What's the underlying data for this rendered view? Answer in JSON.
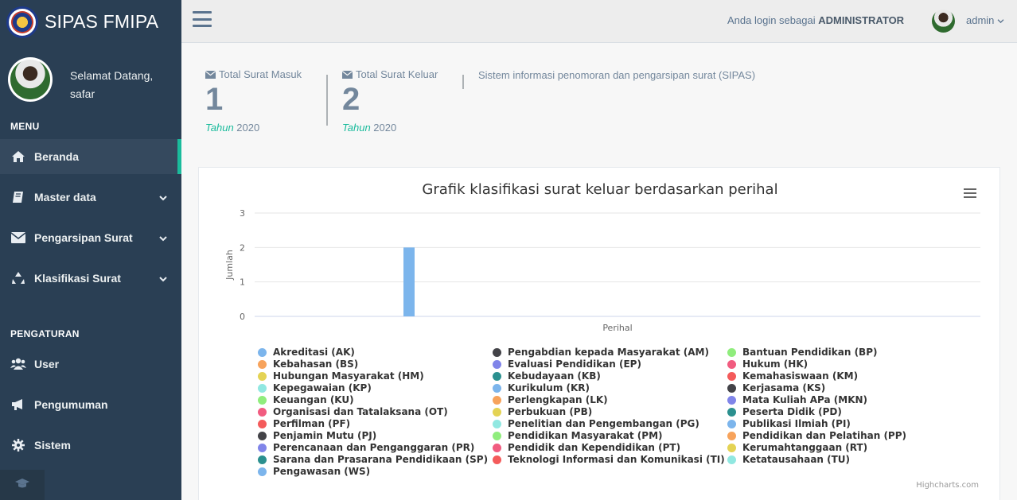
{
  "app": {
    "title": "SIPAS FMIPA"
  },
  "profile": {
    "greeting": "Selamat Datang,",
    "name": "safar"
  },
  "sidebar": {
    "menu_heading": "MENU",
    "items": [
      {
        "label": "Beranda",
        "icon": "home-icon"
      },
      {
        "label": "Master data",
        "icon": "book-icon"
      },
      {
        "label": "Pengarsipan Surat",
        "icon": "envelope-icon"
      },
      {
        "label": "Klasifikasi Surat",
        "icon": "recycle-icon"
      }
    ],
    "settings_heading": "PENGATURAN",
    "settings_items": [
      {
        "label": "User",
        "icon": "users-icon"
      },
      {
        "label": "Pengumuman",
        "icon": "bullhorn-icon"
      },
      {
        "label": "Sistem",
        "icon": "gear-icon"
      }
    ]
  },
  "topnav": {
    "login_prefix": "Anda login sebagai",
    "role": "ADMINISTRATOR",
    "username": "admin"
  },
  "tiles": [
    {
      "label": "Total Surat Masuk",
      "count": "1",
      "year_prefix": "Tahun",
      "year": "2020"
    },
    {
      "label": "Total Surat Keluar",
      "count": "2",
      "year_prefix": "Tahun",
      "year": "2020"
    }
  ],
  "system_info": "Sistem informasi penomoran dan pengarsipan surat (SIPAS)",
  "chart_data": {
    "type": "bar",
    "title": "Grafik klasifikasi surat keluar berdasarkan perihal",
    "xlabel": "Perihal",
    "ylabel": "Jumlah",
    "ylim": [
      0,
      3
    ],
    "yticks": [
      "0",
      "1",
      "2",
      "3"
    ],
    "categories": [
      "Perihal"
    ],
    "series": [
      {
        "name": "Akreditasi (AK)",
        "color": "#7cb5ec",
        "values": [
          2
        ]
      }
    ],
    "legend": [
      {
        "name": "Akreditasi (AK)",
        "color": "#7cb5ec"
      },
      {
        "name": "Kebahasan (BS)",
        "color": "#f7a35c"
      },
      {
        "name": "Hubungan Masyarakat (HM)",
        "color": "#e4d354"
      },
      {
        "name": "Kepegawaian (KP)",
        "color": "#91e8e1"
      },
      {
        "name": "Keuangan (KU)",
        "color": "#90ed7d"
      },
      {
        "name": "Organisasi dan Tatalaksana (OT)",
        "color": "#f15c80"
      },
      {
        "name": "Perfilman (PF)",
        "color": "#f45b5b"
      },
      {
        "name": "Penjamin Mutu (PJ)",
        "color": "#434348"
      },
      {
        "name": "Perencanaan dan Penganggaran (PR)",
        "color": "#8085e9"
      },
      {
        "name": "Sarana dan Prasarana Pendidikaan (SP)",
        "color": "#2b908f"
      },
      {
        "name": "Pengawasan (WS)",
        "color": "#7cb5ec"
      },
      {
        "name": "Pengabdian kepada Masyarakat (AM)",
        "color": "#434348"
      },
      {
        "name": "Evaluasi Pendidikan (EP)",
        "color": "#8085e9"
      },
      {
        "name": "Kebudayaan (KB)",
        "color": "#2b908f"
      },
      {
        "name": "Kurikulum (KR)",
        "color": "#7cb5ec"
      },
      {
        "name": "Perlengkapan (LK)",
        "color": "#f7a35c"
      },
      {
        "name": "Perbukuan (PB)",
        "color": "#e4d354"
      },
      {
        "name": "Penelitian dan Pengembangan (PG)",
        "color": "#91e8e1"
      },
      {
        "name": "Pendidikan Masyarakat (PM)",
        "color": "#90ed7d"
      },
      {
        "name": "Pendidik dan Kependidikan (PT)",
        "color": "#f15c80"
      },
      {
        "name": "Teknologi Informasi dan Komunikasi (TI)",
        "color": "#f45b5b"
      },
      {
        "name": "Bantuan Pendidikan (BP)",
        "color": "#90ed7d"
      },
      {
        "name": "Hukum (HK)",
        "color": "#f15c80"
      },
      {
        "name": "Kemahasiswaan (KM)",
        "color": "#f45b5b"
      },
      {
        "name": "Kerjasama (KS)",
        "color": "#434348"
      },
      {
        "name": "Mata Kuliah APa (MKN)",
        "color": "#8085e9"
      },
      {
        "name": "Peserta Didik (PD)",
        "color": "#2b908f"
      },
      {
        "name": "Publikasi Ilmiah (PI)",
        "color": "#7cb5ec"
      },
      {
        "name": "Pendidikan dan Pelatihan (PP)",
        "color": "#f7a35c"
      },
      {
        "name": "Kerumahtanggaan (RT)",
        "color": "#e4d354"
      },
      {
        "name": "Ketatausahaan (TU)",
        "color": "#91e8e1"
      }
    ],
    "credits": "Highcharts.com",
    "grid": true,
    "legend_position": "bottom"
  }
}
